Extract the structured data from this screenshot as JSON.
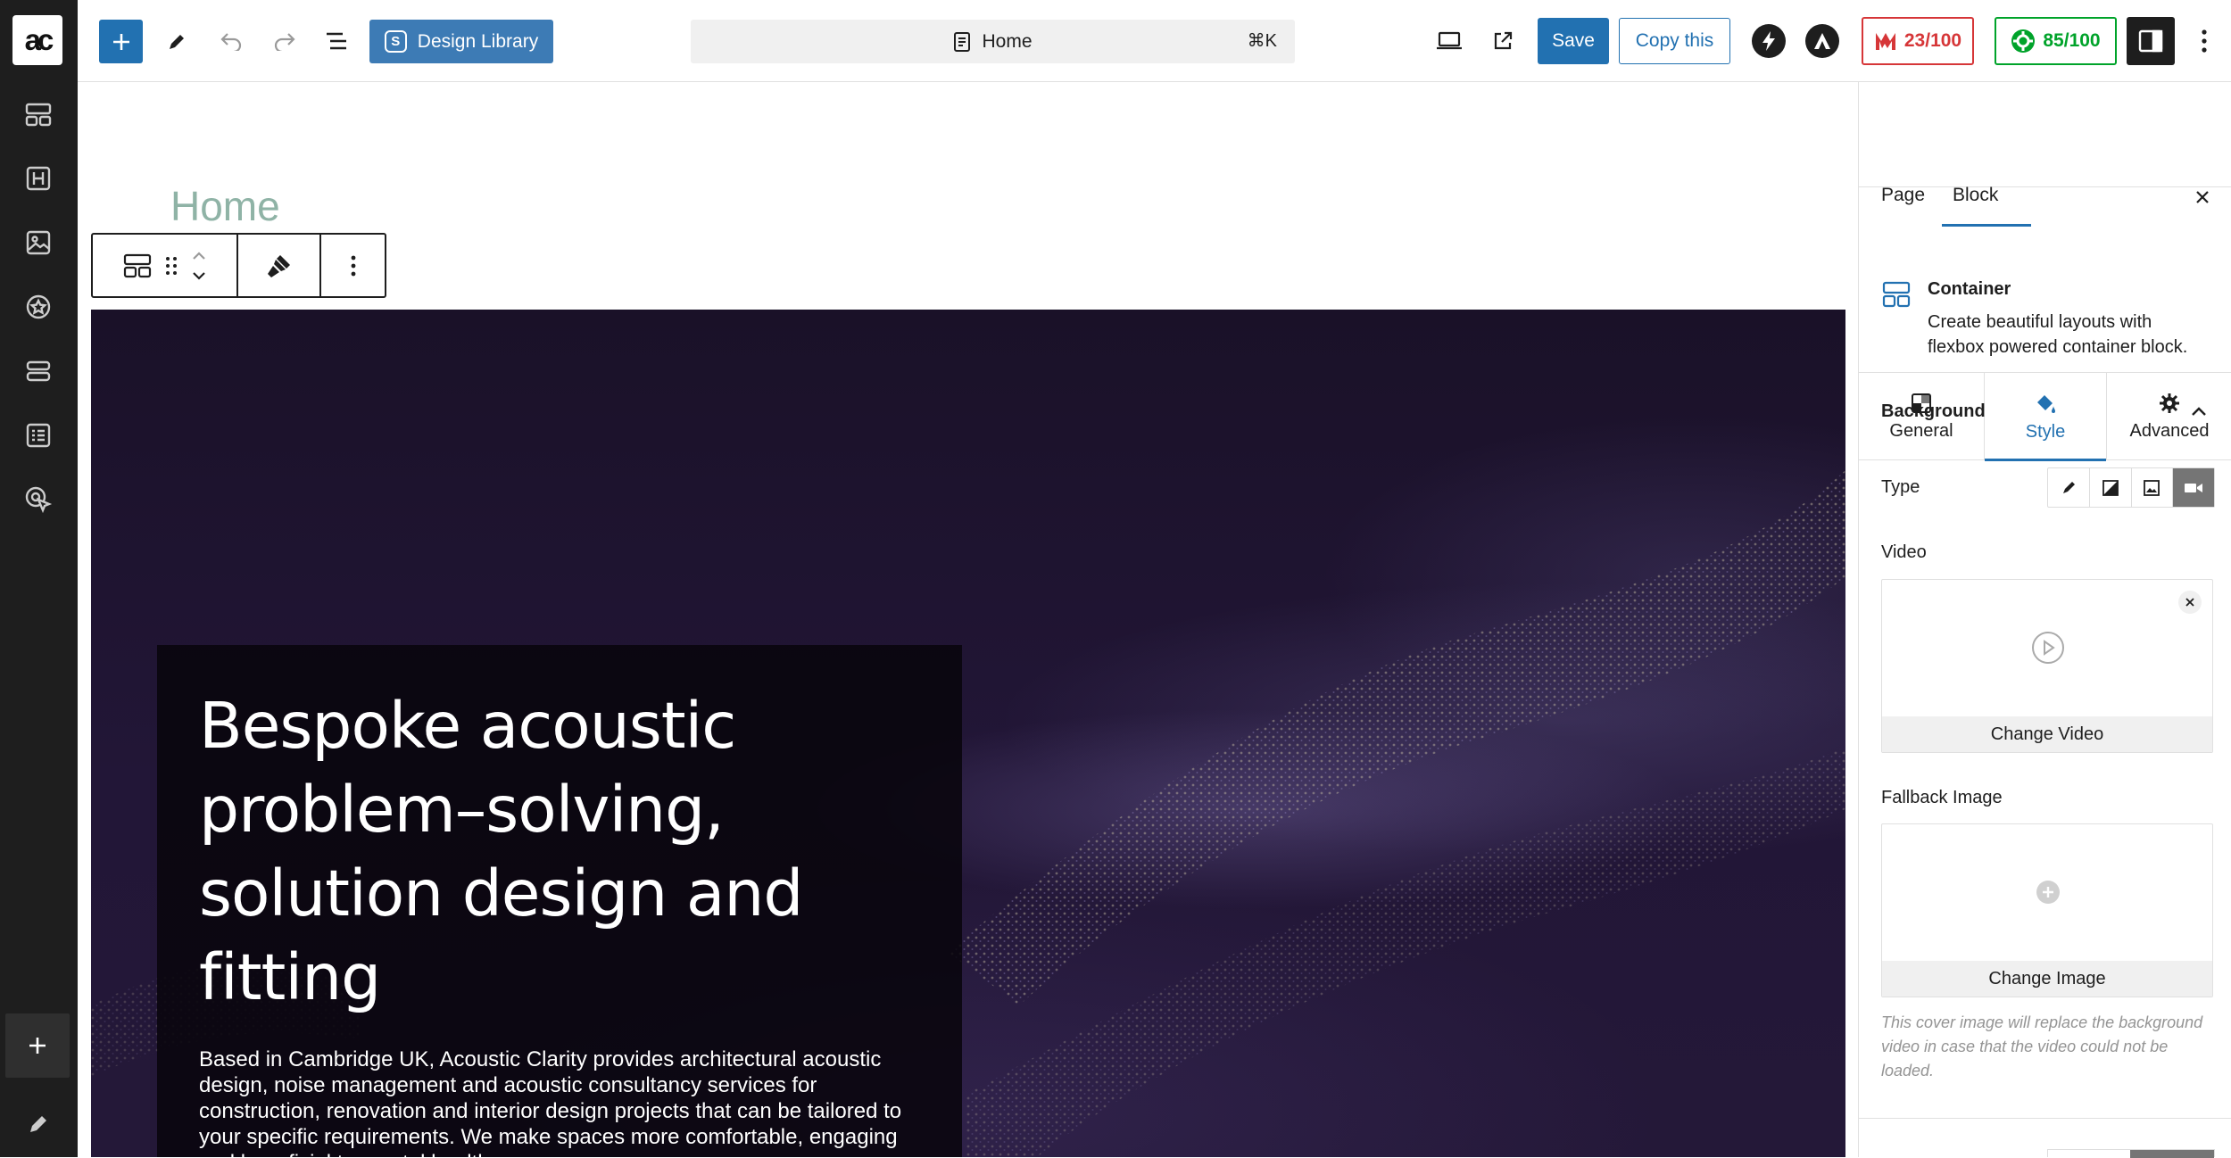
{
  "app": {
    "logo_text": "ac"
  },
  "toolbar": {
    "design_library_label": "Design Library",
    "command_title": "Home",
    "command_shortcut": "⌘K",
    "save_label": "Save",
    "copy_label": "Copy this",
    "score_readability": "23/100",
    "score_seo": "85/100"
  },
  "editor": {
    "page_title": "Home",
    "hero_heading": "Bespoke acoustic problem–solving, solution design and fitting",
    "hero_text": "Based in Cambridge UK, Acoustic Clarity provides architectural acoustic design, noise management and acoustic consultancy services for construction, renovation and interior design projects that can be tailored to your specific requirements. We make spaces more comfortable, engaging and beneficial to mental health."
  },
  "panel": {
    "tab_page": "Page",
    "tab_block": "Block",
    "block_name": "Container",
    "block_desc": "Create beautiful layouts with flexbox powered container block.",
    "tab_general": "General",
    "tab_style": "Style",
    "tab_advanced": "Advanced",
    "section_background": "Background",
    "type_label": "Type",
    "video_label": "Video",
    "change_video": "Change Video",
    "fallback_label": "Fallback Image",
    "change_image": "Change Image",
    "fallback_help": "This cover image will replace the background video in case that the video could not be loaded."
  },
  "colors": {
    "accent": "#2271b1",
    "score_bad": "#d63638",
    "score_good": "#00a32a",
    "hero_bg": "#1f1530"
  }
}
